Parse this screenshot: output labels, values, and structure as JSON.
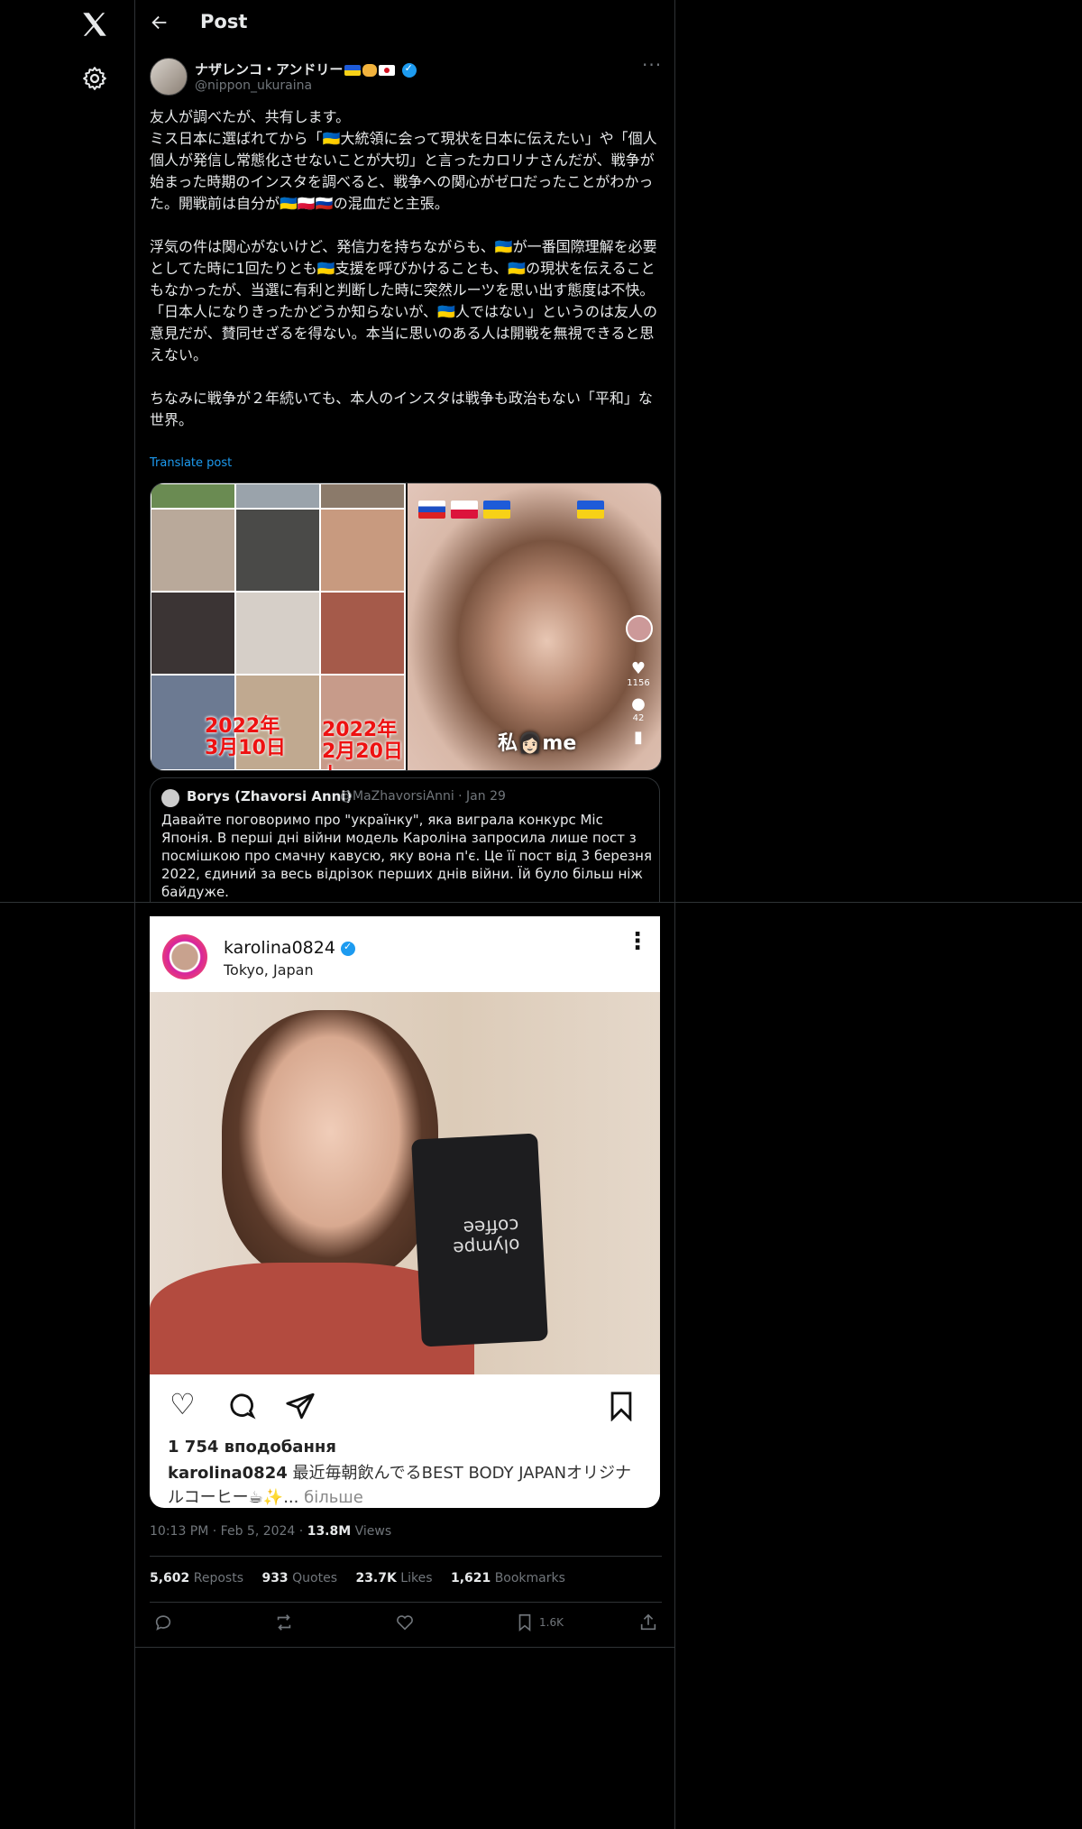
{
  "header": {
    "title": "Post"
  },
  "author": {
    "name": "ナザレンコ・アンドリー",
    "handle": "@nippon_ukuraina"
  },
  "post": {
    "text": "友人が調べたが、共有します。\nミス日本に選ばれてから「🇺🇦大統領に会って現状を日本に伝えたい」や「個人個人が発信し常態化させないことが大切」と言ったカロリナさんだが、戦争が始まった時期のインスタを調べると、戦争への関心がゼロだったことがわかった。開戦前は自分が🇺🇦🇵🇱🇷🇺の混血だと主張。\n\n浮気の件は関心がないけど、発信力を持ちながらも、🇺🇦が一番国際理解を必要としてた時に1回たりとも🇺🇦支援を呼びかけることも、🇺🇦の現状を伝えることもなかったが、当選に有利と判断した時に突然ルーツを思い出す態度は不快。\n「日本人になりきったかどうか知らないが、🇺🇦人ではない」というのは友人の意見だが、賛同せざるを得ない。本当に思いのある人は開戦を無視できると思えない。\n\nちなみに戦争が２年続いても、本人のインスタは戦争も政治もない「平和」な世界。",
    "translate": "Translate post"
  },
  "media": {
    "date_left": "2022年\n3月10日",
    "date_right": "2022年\n2月20日↓",
    "video_caption": "私👩🏻me",
    "video_likes": "1156",
    "video_comments": "42"
  },
  "quote": {
    "name": "Borys (Zhavorsi Anni)",
    "handle": "@MaZhavorsiAnni · Jan 29",
    "text": "Давайте поговоримо про \"українку\", яка виграла конкурс Міс Японія. В перші дні війни модель Кароліна запросила лише пост з посмішкою про смачну кавусю, яку вона п'є. Це її пост від 3 березня 2022, єдиний за весь відрізок перших днів війни. Їй було більш ніж байдуже."
  },
  "instagram": {
    "username": "karolina0824",
    "location": "Tokyo, Japan",
    "likes": "1 754 вподобання",
    "caption_user": "karolina0824",
    "caption_text": "最近毎朝飲んでるBEST BODY JAPANオリジナルコーヒー☕✨...",
    "caption_more": "більше",
    "bag_text": "olympe\ncoffee"
  },
  "meta": {
    "time": "10:13 PM · Feb 5, 2024 · ",
    "views": "13.8M",
    "views_label": " Views"
  },
  "stats": {
    "reposts": "5,602",
    "reposts_label": " Reposts",
    "quotes": "933",
    "quotes_label": " Quotes",
    "likes": "23.7K",
    "likes_label": " Likes",
    "bookmarks": "1,621",
    "bookmarks_label": " Bookmarks"
  },
  "actions": {
    "bookmark_count": "1.6K"
  },
  "colors": {
    "accent": "#1d9bf0",
    "background": "#000000",
    "border": "#2f3336",
    "muted": "#71767b"
  },
  "icons": [
    "x-logo-icon",
    "gear-icon",
    "back-arrow-icon",
    "verified-icon",
    "more-icon",
    "reply-icon",
    "repost-icon",
    "like-icon",
    "bookmark-icon",
    "share-icon"
  ]
}
